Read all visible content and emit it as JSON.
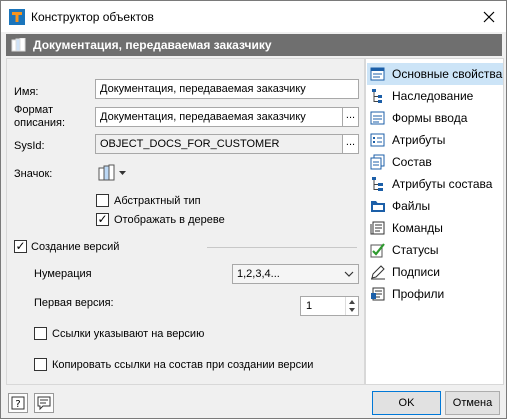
{
  "window": {
    "title": "Конструктор объектов"
  },
  "header": {
    "title": "Документация, передаваемая заказчику"
  },
  "form": {
    "name_label": "Имя:",
    "name_value": "Документация, передаваемая заказчику",
    "format_label_1": "Формат",
    "format_label_2": "описания:",
    "format_value": "Документация, передаваемая заказчику",
    "ellipsis": "...",
    "sysid_label": "SysId:",
    "sysid_value": "OBJECT_DOCS_FOR_CUSTOMER",
    "icon_label": "Значок:",
    "abstract_label": "Абстрактный тип",
    "abstract_checked": false,
    "show_tree_label": "Отображать в дереве",
    "show_tree_checked": true,
    "versions_label": "Создание версий",
    "versions_checked": true,
    "numbering_label": "Нумерация",
    "numbering_value": "1,2,3,4...",
    "first_version_label": "Первая версия:",
    "first_version_value": "1",
    "links_to_version_label": "Ссылки указывают на версию",
    "links_to_version_checked": false,
    "copy_links_label": "Копировать ссылки на состав при создании версии",
    "copy_links_checked": false
  },
  "nav": {
    "items": [
      {
        "label": "Основные свойства",
        "icon": "properties-icon",
        "active": true
      },
      {
        "label": "Наследование",
        "icon": "inheritance-icon",
        "active": false
      },
      {
        "label": "Формы ввода",
        "icon": "input-forms-icon",
        "active": false
      },
      {
        "label": "Атрибуты",
        "icon": "attributes-icon",
        "active": false
      },
      {
        "label": "Состав",
        "icon": "composition-icon",
        "active": false
      },
      {
        "label": "Атрибуты состава",
        "icon": "composition-attributes-icon",
        "active": false
      },
      {
        "label": "Файлы",
        "icon": "files-icon",
        "active": false
      },
      {
        "label": "Команды",
        "icon": "commands-icon",
        "active": false
      },
      {
        "label": "Статусы",
        "icon": "statuses-icon",
        "active": false
      },
      {
        "label": "Подписи",
        "icon": "signatures-icon",
        "active": false
      },
      {
        "label": "Профили",
        "icon": "profiles-icon",
        "active": false
      }
    ]
  },
  "footer": {
    "ok_label": "OK",
    "cancel_label": "Отмена"
  },
  "colors": {
    "header_bg": "#6f6f6f",
    "nav_active": "#cce4f7",
    "accent": "#0078d7"
  }
}
